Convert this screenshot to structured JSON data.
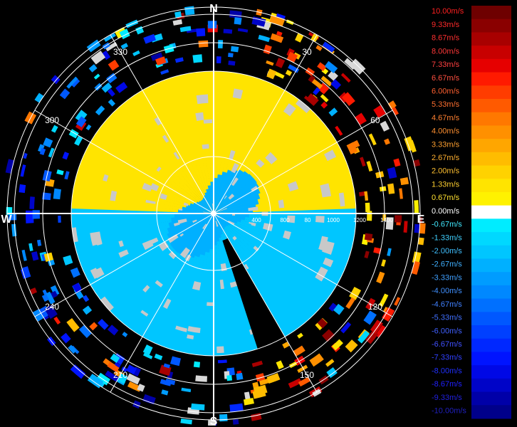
{
  "chart_data": {
    "type": "heatmap",
    "subtype": "polar radial-velocity (PPI) display",
    "compass_labels": {
      "north": "N",
      "east": "E",
      "south": "S",
      "west": "W"
    },
    "bearing_labels": [
      {
        "deg": 30,
        "text": "30"
      },
      {
        "deg": 60,
        "text": "60"
      },
      {
        "deg": 120,
        "text": "120"
      },
      {
        "deg": 150,
        "text": "150"
      },
      {
        "deg": 210,
        "text": "210"
      },
      {
        "deg": 240,
        "text": "240"
      },
      {
        "deg": 300,
        "text": "300"
      },
      {
        "deg": 330,
        "text": "330"
      }
    ],
    "range_rings": [
      400,
      800,
      1000,
      1200,
      1400
    ],
    "range_labels": [
      "400",
      "800",
      "80",
      "1000",
      "1200",
      "1400"
    ],
    "range_max": 1450,
    "grid": true,
    "colorbar": {
      "unit": "m/s",
      "labels": [
        "10.00m/s",
        "9.33m/s",
        "8.67m/s",
        "8.00m/s",
        "7.33m/s",
        "6.67m/s",
        "6.00m/s",
        "5.33m/s",
        "4.67m/s",
        "4.00m/s",
        "3.33m/s",
        "2.67m/s",
        "2.00m/s",
        "1.33m/s",
        "0.67m/s",
        "0.00m/s",
        "-0.67m/s",
        "-1.33m/s",
        "-2.00m/s",
        "-2.67m/s",
        "-3.33m/s",
        "-4.00m/s",
        "-4.67m/s",
        "-5.33m/s",
        "-6.00m/s",
        "-6.67m/s",
        "-7.33m/s",
        "-8.00m/s",
        "-8.67m/s",
        "-9.33m/s",
        "-10.00m/s"
      ],
      "colors": [
        "#6e0000",
        "#8a0000",
        "#a80000",
        "#c80000",
        "#e60000",
        "#ff1a00",
        "#ff3c00",
        "#ff5a00",
        "#ff7800",
        "#ff9000",
        "#ffa600",
        "#ffbc00",
        "#ffd200",
        "#ffe400",
        "#fff200",
        "#ffffff",
        "#00ecff",
        "#00d8ff",
        "#00c6ff",
        "#00b0ff",
        "#009cff",
        "#0088ff",
        "#0070ff",
        "#0058ff",
        "#0040ff",
        "#0028ff",
        "#0014ff",
        "#0008e6",
        "#0004c8",
        "#0000a8",
        "#00008a"
      ],
      "label_colors": [
        "#ff2020",
        "#ff2a2a",
        "#ff3030",
        "#ff3838",
        "#ff4040",
        "#ff5040",
        "#ff6030",
        "#ff7030",
        "#ff8030",
        "#ff9030",
        "#ffa030",
        "#ffb030",
        "#ffc030",
        "#ffd030",
        "#ffe030",
        "#ffffff",
        "#40e8ff",
        "#40d0ff",
        "#40c0ff",
        "#40b0ff",
        "#40a0ff",
        "#4090ff",
        "#4080ff",
        "#4070ff",
        "#4060ff",
        "#4050ff",
        "#3040ff",
        "#2030ff",
        "#2020ff",
        "#2020e0",
        "#2020c0"
      ]
    },
    "regions": {
      "core_positive": {
        "value_ms": 1.5,
        "sector": "north half (approx. 270°–90° through 0°), range 0–1000 m"
      },
      "core_negative": {
        "value_ms": -2.0,
        "sector": "south half (approx. 90°–270° through 180°), range 0–1000 m"
      },
      "no_data_wedge": {
        "sector": "approx. 150°–162°, range 200–1000 m"
      }
    },
    "scattered_returns": "sparse bins beyond 1000 m, mixed positive (red/orange/yellow) toward east and south-east, mixed negative (blue) toward west and north-west"
  }
}
